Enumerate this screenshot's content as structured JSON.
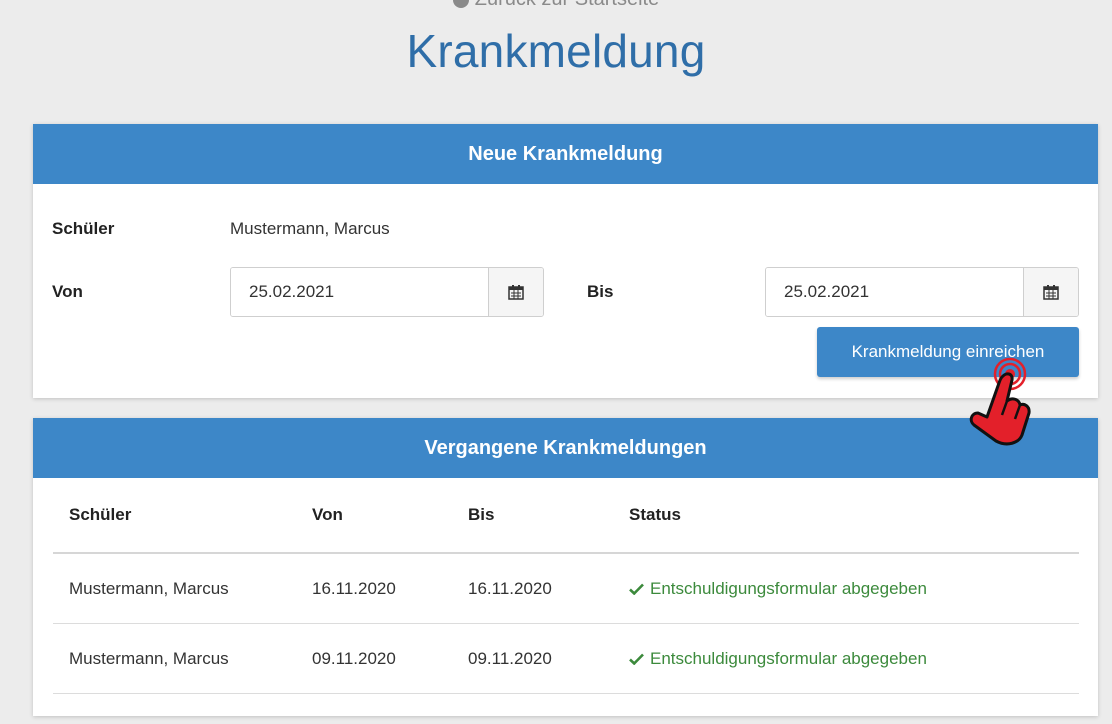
{
  "header": {
    "back_label": "Zurück zur Startseite",
    "title": "Krankmeldung"
  },
  "new_report": {
    "title": "Neue Krankmeldung",
    "student_label": "Schüler",
    "student_value": "Mustermann, Marcus",
    "from_label": "Von",
    "from_value": "25.02.2021",
    "to_label": "Bis",
    "to_value": "25.02.2021",
    "calendar_icon": "calendar-icon",
    "submit_label": "Krankmeldung einreichen"
  },
  "past_reports": {
    "title": "Vergangene Krankmeldungen",
    "columns": [
      "Schüler",
      "Von",
      "Bis",
      "Status"
    ],
    "rows": [
      {
        "student": "Mustermann, Marcus",
        "from": "16.11.2020",
        "to": "16.11.2020",
        "status": "Entschuldigungsformular abgegeben"
      },
      {
        "student": "Mustermann, Marcus",
        "from": "09.11.2020",
        "to": "09.11.2020",
        "status": "Entschuldigungsformular abgegeben"
      }
    ]
  },
  "colors": {
    "accent": "#3d87c8",
    "title": "#2f6ea8",
    "status_ok": "#3c8a3c",
    "cursor_hand": "#e3202a"
  }
}
